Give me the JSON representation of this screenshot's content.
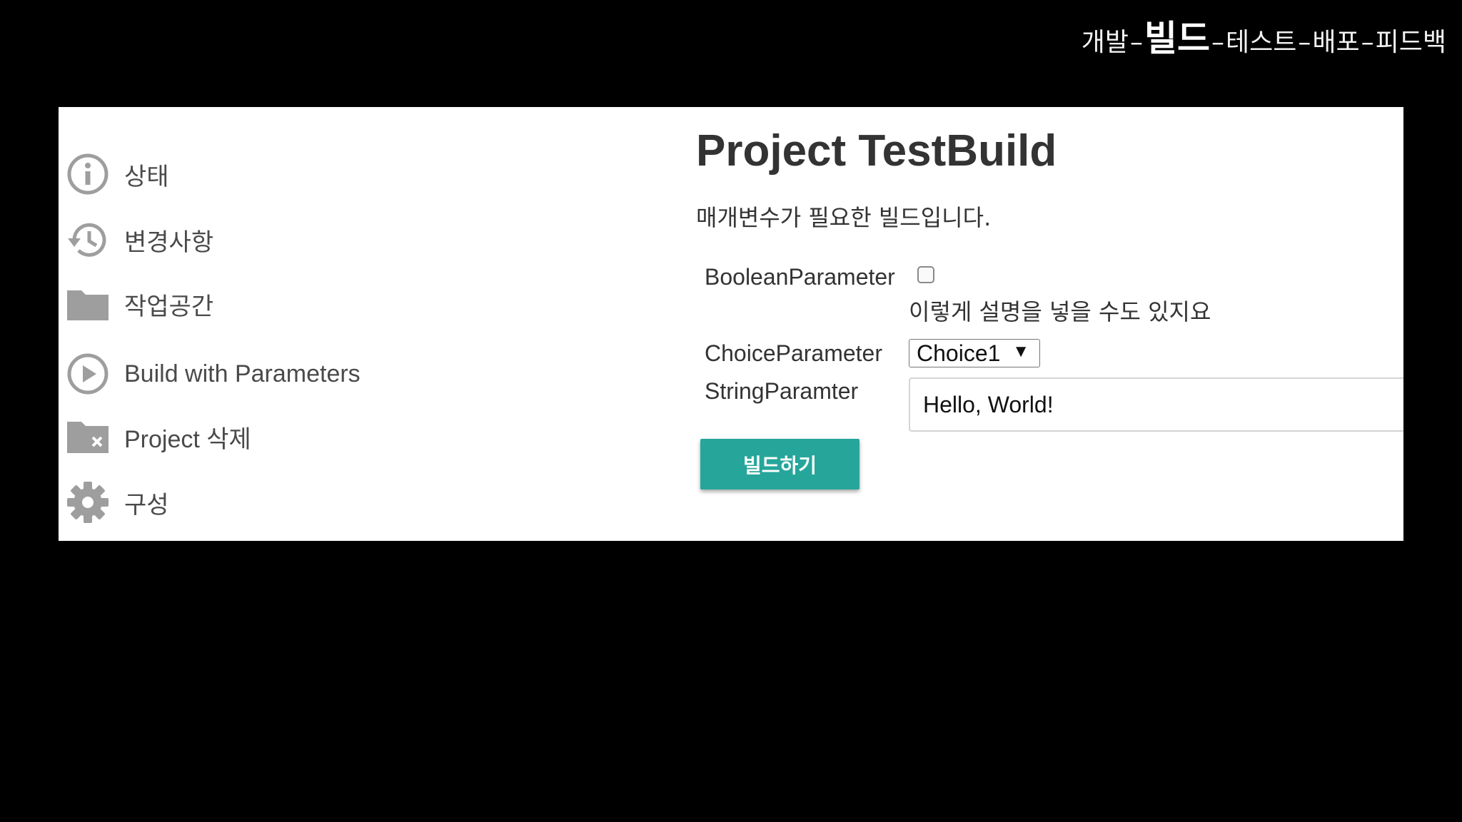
{
  "pipeline": {
    "steps": [
      "개발",
      "빌드",
      "테스트",
      "배포",
      "피드백"
    ],
    "separator": "–",
    "active_step": "빌드"
  },
  "sidebar": {
    "items": [
      {
        "label": "상태",
        "icon": "info-icon"
      },
      {
        "label": "변경사항",
        "icon": "history-icon"
      },
      {
        "label": "작업공간",
        "icon": "folder-icon"
      },
      {
        "label": "Build with Parameters",
        "icon": "play-circle-icon"
      },
      {
        "label": "Project 삭제",
        "icon": "folder-delete-icon"
      },
      {
        "label": "구성",
        "icon": "gear-icon"
      }
    ]
  },
  "main": {
    "title": "Project TestBuild",
    "description": "매개변수가 필요한 빌드입니다.",
    "boolean_param": {
      "label": "BooleanParameter",
      "checked": false,
      "description": "이렇게 설명을 넣을 수도 있지요"
    },
    "choice_param": {
      "label": "ChoiceParameter",
      "selected": "Choice1",
      "arrow": "▼"
    },
    "string_param": {
      "label": "StringParamter",
      "value": "Hello, World!"
    },
    "build_button": "빌드하기"
  },
  "colors": {
    "background": "#000000",
    "panel": "#ffffff",
    "icon_gray": "#9e9e9e",
    "build_button": "#26a69a"
  }
}
